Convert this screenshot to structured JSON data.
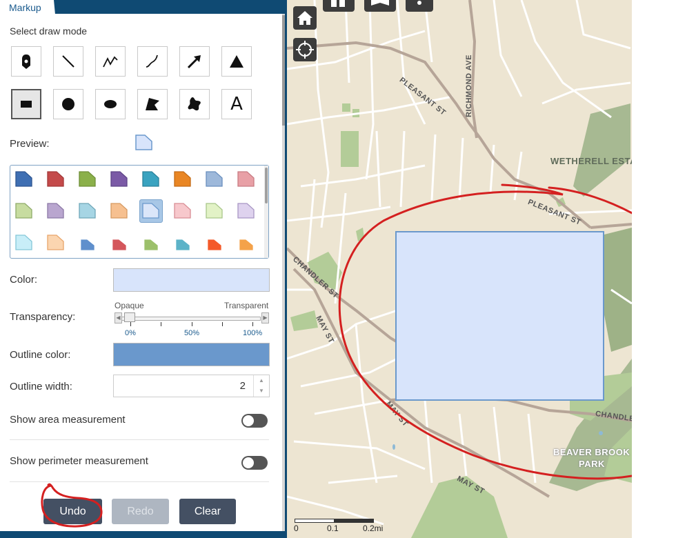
{
  "panel": {
    "tab_title": "Markup",
    "select_draw_mode": "Select draw mode",
    "preview_label": "Preview:",
    "color_label": "Color:",
    "transparency_label": "Transparency:",
    "opaque_label": "Opaque",
    "transparent_label": "Transparent",
    "tick_0": "0%",
    "tick_50": "50%",
    "tick_100": "100%",
    "transparency_value": 0,
    "outline_color_label": "Outline color:",
    "outline_width_label": "Outline width:",
    "outline_width_value": "2",
    "show_area_label": "Show area measurement",
    "show_perimeter_label": "Show perimeter measurement",
    "show_area_on": false,
    "show_perimeter_on": false,
    "fill_color": "#d8e4fb",
    "outline_color": "#6a98cc"
  },
  "draw_modes": [
    {
      "name": "point",
      "icon": "map-pin-icon"
    },
    {
      "name": "line",
      "icon": "line-icon"
    },
    {
      "name": "polyline",
      "icon": "polyline-icon"
    },
    {
      "name": "freehand-line",
      "icon": "freehand-line-icon"
    },
    {
      "name": "arrow",
      "icon": "arrow-icon"
    },
    {
      "name": "triangle",
      "icon": "triangle-icon"
    },
    {
      "name": "rectangle",
      "icon": "rectangle-icon",
      "selected": true
    },
    {
      "name": "circle",
      "icon": "circle-icon"
    },
    {
      "name": "ellipse",
      "icon": "ellipse-icon"
    },
    {
      "name": "polygon",
      "icon": "polygon-icon"
    },
    {
      "name": "freehand-polygon",
      "icon": "freehand-polygon-icon"
    },
    {
      "name": "text",
      "icon": "text-icon",
      "glyph": "A"
    }
  ],
  "swatches": [
    "#3f6fb3",
    "#c44a4a",
    "#8bb04a",
    "#7b5aa6",
    "#3aa3c0",
    "#e98624",
    "#9db8da",
    "#e8a0a6",
    "#c7dca0",
    "#b9a6cf",
    "#a6d5e4",
    "#f6c090",
    "#dbe6f9",
    "#f7c8cc",
    "#e2f2c6",
    "#ded2ee",
    "#c8eef8",
    "#fbd5b0",
    "#5f8fcc",
    "#d4575c",
    "#9cc06b",
    "#5db3c8",
    "#f45a2a",
    "#f4a24a"
  ],
  "swatch_outlines": [
    "#2d5590",
    "#a33838",
    "#6f8f38",
    "#5e4487",
    "#2a829b",
    "#c46b16",
    "#6a8fbe",
    "#c87b82",
    "#8fab6a",
    "#8c79a6",
    "#6fa7b8",
    "#d69a62",
    "#6a98cc",
    "#d88d94",
    "#a9c78a",
    "#a896c4",
    "#84c7d8",
    "#e8a56a",
    "#5f8fcc",
    "#d4575c",
    "#9cc06b",
    "#5db3c8",
    "#f45a2a",
    "#f4a24a"
  ],
  "selected_swatch": 12,
  "buttons": {
    "undo": "Undo",
    "redo": "Redo",
    "clear": "Clear"
  },
  "map": {
    "streets": {
      "pleasant_st_1": "PLEASANT ST",
      "richmond_ave": "RICHMOND AVE",
      "pleasant_st_2": "PLEASANT ST",
      "chandler_st_1": "CHANDLER ST",
      "may_st_1": "MAY ST",
      "may_st_2": "MAY ST",
      "may_st_3": "MAY ST",
      "chandler_2": "CHANDLE"
    },
    "areas": {
      "wetherell": "WETHERELL ESTA",
      "beaver_brook_1": "BEAVER BROOK",
      "beaver_brook_2": "PARK"
    },
    "scale": {
      "t0": "0",
      "t1": "0.1",
      "t2": "0.2mi"
    },
    "annotation_color": "#d42020"
  }
}
